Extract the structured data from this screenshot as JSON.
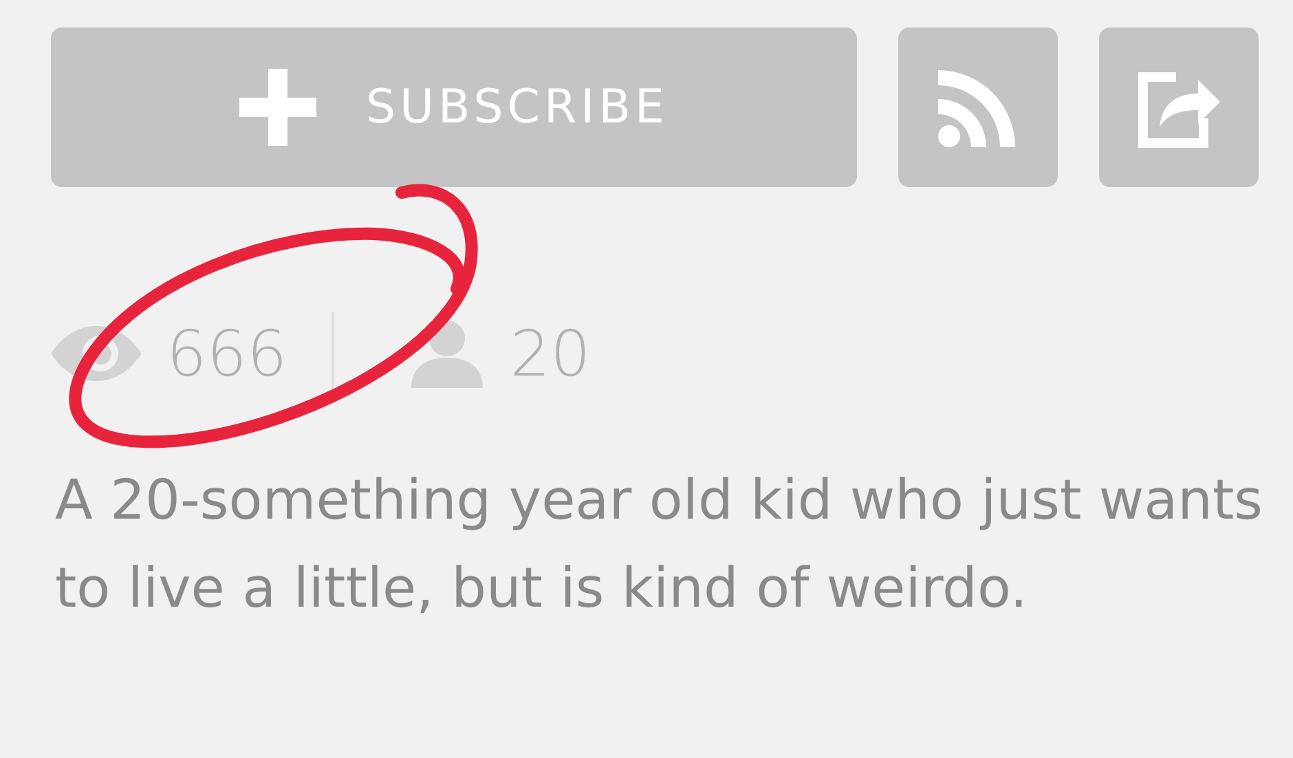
{
  "subscribe_button": {
    "label": "SUBSCRIBE"
  },
  "stats": {
    "views": "666",
    "subscribers": "20"
  },
  "description": "A 20-something year old kid who just wants to live a little, but is kind of weirdo."
}
